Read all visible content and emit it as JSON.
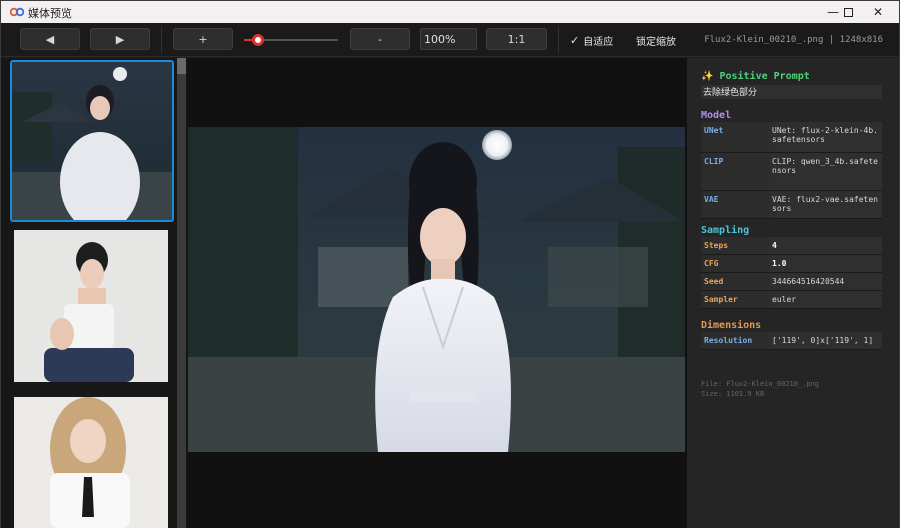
{
  "window": {
    "title": "媒体预览",
    "controls": [
      "minimize-icon",
      "maximize-icon",
      "close-icon"
    ]
  },
  "toolbar": {
    "prev_label": "◀",
    "next_label": "▶",
    "zoom_in_label": "+",
    "zoom_out_label": "-",
    "zoom_value": "100%",
    "actual_size_label": "1:1",
    "fit_label": "自适应",
    "fit_checked": true,
    "lock_zoom_label": "锁定缩放",
    "lock_zoom_checked": false,
    "file_info": "Flux2-Klein_00210_.png | 1248x816",
    "zoom_slider_level": 0.15
  },
  "thumbnails": [
    {
      "name": "moonlit-hanfu-portrait",
      "selected": true
    },
    {
      "name": "white-top-seated-portrait",
      "selected": false
    },
    {
      "name": "blonde-school-uniform-portrait",
      "selected": false
    }
  ],
  "info": {
    "prompt_heading": "✨ Positive Prompt",
    "prompt_text": "去除绿色部分",
    "model_heading": "Model",
    "model_rows": [
      {
        "key": "UNet",
        "value": "UNet: flux-2-klein-4b.safetensors"
      },
      {
        "key": "CLIP",
        "value": "CLIP: qwen_3_4b.safetensors"
      },
      {
        "key": "VAE",
        "value": "VAE: flux2-vae.safetensors"
      }
    ],
    "sampling_heading": "Sampling",
    "sampling_rows": [
      {
        "key": "Steps",
        "value": "4"
      },
      {
        "key": "CFG",
        "value": "1.0"
      },
      {
        "key": "Seed",
        "value": "344664516420544"
      },
      {
        "key": "Sampler",
        "value": "euler"
      }
    ],
    "dimensions_heading": "Dimensions",
    "dimension_rows": [
      {
        "key": "Resolution",
        "value": "['119', 0]x['119', 1]"
      }
    ],
    "footer_file": "File: Flux2-Klein_00210_.png",
    "footer_size": "Size: 1101.9 KB"
  },
  "colors": {
    "accent": "#1e8ad6",
    "model_heading": "#b48ee8",
    "sampling_heading": "#4ec3d6",
    "dimensions_heading": "#e39a52",
    "prompt_heading": "#4fd07a",
    "model_key": "#7aaee8",
    "sampling_key": "#e8a35a",
    "dimension_key": "#7aaee8"
  }
}
